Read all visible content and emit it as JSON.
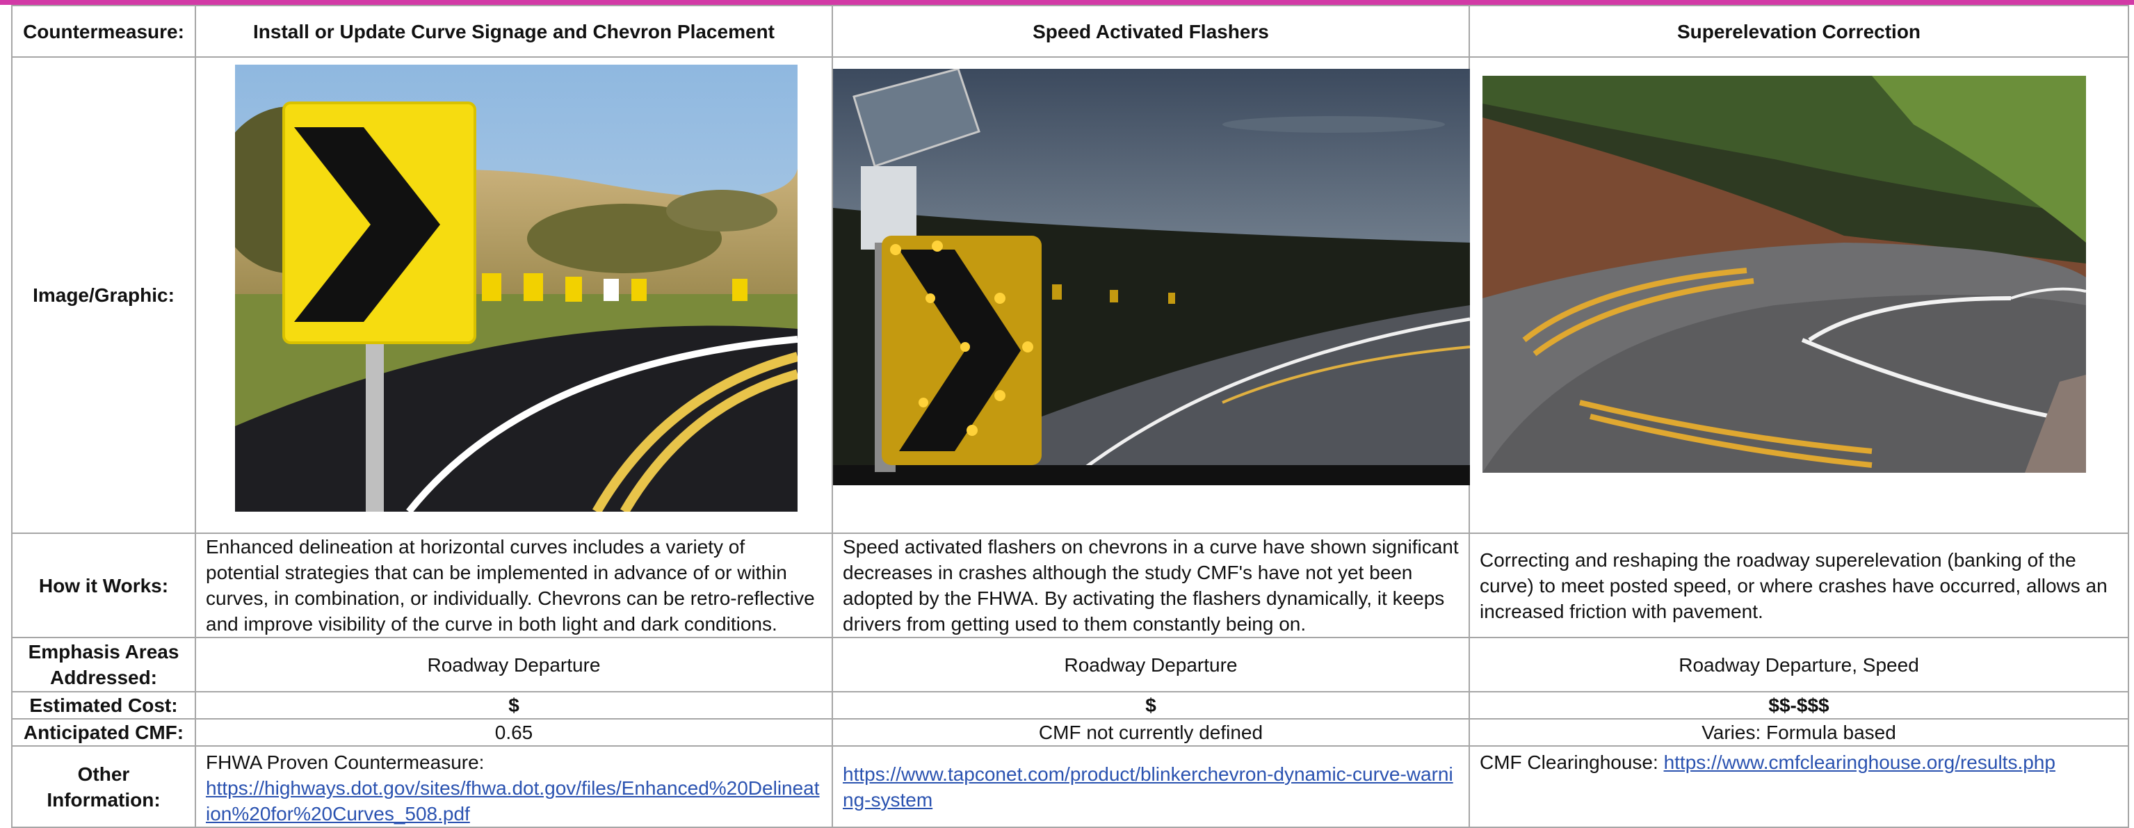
{
  "labels": {
    "countermeasure": "Countermeasure:",
    "image": "Image/Graphic:",
    "how": "How it Works:",
    "emphasis": "Emphasis Areas Addressed:",
    "cost": "Estimated Cost:",
    "cmf": "Anticipated CMF:",
    "other": "Other Information:"
  },
  "columns": [
    {
      "title": "Install or Update Curve Signage and Chevron Placement",
      "how": "Enhanced delineation at horizontal curves includes a variety of potential strategies that can be implemented in advance of or within curves, in combination, or individually. Chevrons can be retro-reflective and improve visibility of the curve in both light and dark conditions.",
      "emphasis": "Roadway Departure",
      "cost": "$",
      "cmf": "0.65",
      "other_text": "FHWA Proven Countermeasure:",
      "other_link": "https://highways.dot.gov/sites/fhwa.dot.gov/files/Enhanced%20Delineation%20for%20Curves_508.pdf"
    },
    {
      "title": "Speed Activated Flashers",
      "how": "Speed activated flashers on chevrons in a curve have shown significant decreases in crashes although the study CMF's have not yet been adopted by the FHWA.  By activating the flashers dynamically, it keeps drivers from getting used to them constantly being on.",
      "emphasis": "Roadway Departure",
      "cost": "$",
      "cmf": "CMF not currently defined",
      "other_text": "",
      "other_link": "https://www.tapconet.com/product/blinkerchevron-dynamic-curve-warning-system"
    },
    {
      "title": "Superelevation Correction",
      "how": "Correcting and reshaping the roadway superelevation (banking of the curve) to meet posted speed, or where crashes have occurred, allows an increased friction with pavement.",
      "emphasis": "Roadway Departure, Speed",
      "cost": "$$-$$$",
      "cmf": "Varies: Formula based",
      "other_text": "CMF Clearinghouse:",
      "other_link": "https://www.cmfclearinghouse.org/results.php"
    }
  ],
  "images": {
    "col1": "chevron-sign-photo",
    "col2": "speed-activated-flasher-photo",
    "col3": "winding-road-photo"
  },
  "colors": {
    "accent_bar": "#d23aa6",
    "label_text": "#7b1a5a",
    "link": "#2a52b0",
    "border": "#a6a6a6"
  }
}
